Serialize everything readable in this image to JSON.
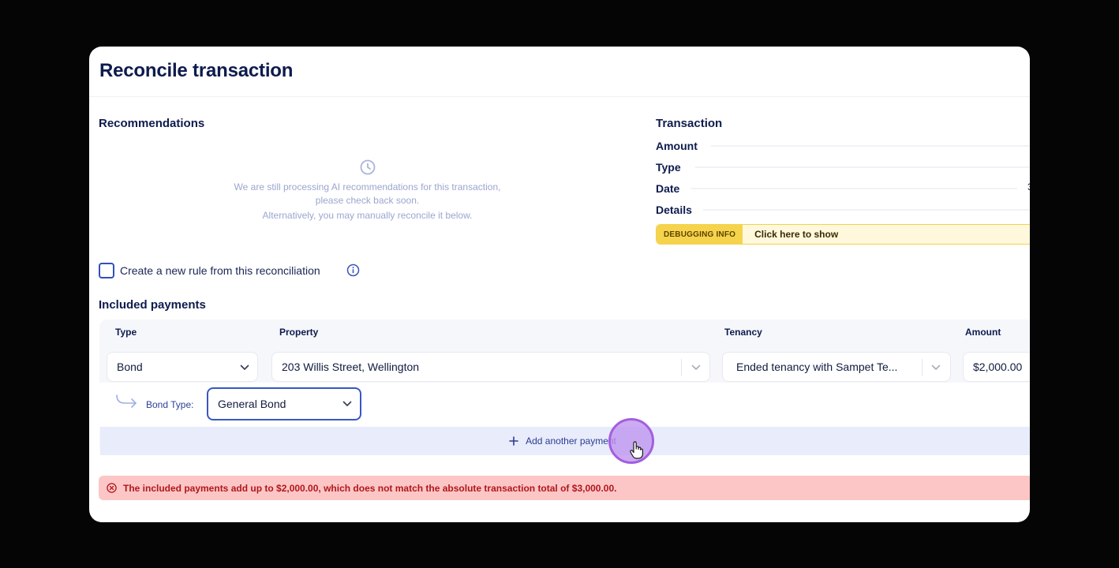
{
  "modal": {
    "title": "Reconcile transaction"
  },
  "recommendations": {
    "heading": "Recommendations",
    "line1": "We are still processing AI recommendations for this transaction,",
    "line2": "please check back soon.",
    "line3": "Alternatively, you may manually reconcile it below."
  },
  "transaction": {
    "heading": "Transaction",
    "fields": [
      "Amount",
      "Type",
      "Date",
      "Details"
    ],
    "date_trailing": "3",
    "debug": {
      "badge": "DEBUGGING INFO",
      "link": "Click here to show"
    }
  },
  "rule": {
    "label": "Create a new rule from this reconciliation",
    "checked": false
  },
  "payments": {
    "heading": "Included payments",
    "columns": {
      "type": "Type",
      "property": "Property",
      "tenancy": "Tenancy",
      "amount": "Amount"
    },
    "row": {
      "type": "Bond",
      "property": "203 Willis Street, Wellington",
      "tenancy": "Ended tenancy with Sampet Te...",
      "amount": "$2,000.00"
    },
    "bond_type": {
      "label": "Bond Type:",
      "value": "General Bond"
    },
    "add_label": "Add another payment"
  },
  "error": {
    "message": "The included payments add up to $2,000.00, which does not match the absolute transaction total of $3,000.00."
  },
  "colors": {
    "accent": "#3957c2",
    "error_bg": "#fcc6c6",
    "error_text": "#b0171b",
    "debug": "#f6d34c",
    "cursor_halo": "#a35ee0"
  }
}
